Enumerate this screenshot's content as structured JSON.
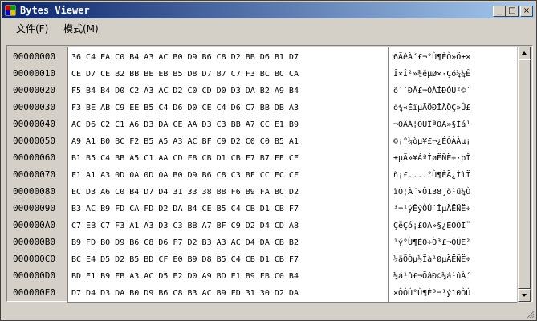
{
  "window": {
    "title": "Bytes Viewer"
  },
  "title_buttons": {
    "minimize": "_",
    "maximize": "□",
    "close": "×"
  },
  "menu": [
    {
      "label": "文件(F)"
    },
    {
      "label": "模式(M)"
    }
  ],
  "rows": [
    {
      "addr": "00000000",
      "hex": "36 C4 EA C0 B4 A3 AC B0  D9 B6 C8 D2 BB D6 B1 D7",
      "ascii": "6ÄêÀ´£¬°Ù¶ÈÒ»Ö±×"
    },
    {
      "addr": "00000010",
      "hex": "CE D7 CE B2 BB BE EB B5  D8 D7 B7 C7 F3 BC BC CA",
      "ascii": "Î×Î²»¾ëµØ×·Çó¼¼Ê"
    },
    {
      "addr": "00000020",
      "hex": "F5 B4 B4 D0 C2 A3 AC D2  C0 CD D0 D3 DA B2 A9 B4",
      "ascii": "õ´´ÐÂ£¬ÒÀÍÐÓÚ²©´"
    },
    {
      "addr": "00000030",
      "hex": "F3 BE AB C9 EE B5 C4 D6  D0 CE C4 D6 C7 BB DB A3",
      "ascii": "ó¾«ÉîµÄÖÐÎÄÖÇ»Û£"
    },
    {
      "addr": "00000040",
      "hex": "AC D6 C2 C1 A6 D3 DA CE  AA D3 C3 BB A7 CC E1 B9",
      "ascii": "¬ÖÂÁ¦ÓÚÎªÓÃ»§Ìá¹"
    },
    {
      "addr": "00000050",
      "hex": "A9 A1 B0 BC F2 B5 A5 A3  AC BF C9 D2 C0 C0 B5 A1",
      "ascii": "©¡°¼òµ¥£¬¿ÉÒÀÀµ¡"
    },
    {
      "addr": "00000060",
      "hex": "B1 B5 C4 BB A5 C1 AA CD  F8 CB D1 CB F7 B7 FE CE",
      "ascii": "±µÄ»¥ÁªÍøËÑË÷·þÎ"
    },
    {
      "addr": "00000070",
      "hex": "F1 A1 A3 0D 0A 0D 0A B0  D9 B6 C8 C3 BF CC EC CF",
      "ascii": "ñ¡£....°Ù¶ÈÃ¿ÌìÏ"
    },
    {
      "addr": "00000080",
      "hex": "EC D3 A6 C0 B4 D7 D4 31  33 38 B8 F6 B9 FA BC D2",
      "ascii": "ìÓ¦À´×Ô138¸ö¹ú¼Ò"
    },
    {
      "addr": "00000090",
      "hex": "B3 AC B9 FD CA FD D2 DA  B4 CE B5 C4 CB D1 CB F7",
      "ascii": "³¬¹ýÊýÒÚ´ÎµÄËÑË÷"
    },
    {
      "addr": "000000A0",
      "hex": "C7 EB C7 F3 A1 A3 D3 C3  BB A7 BF C9 D2 D4 CD A8",
      "ascii": "ÇëÇó¡£ÓÃ»§¿ÉÒÔÍ¨"
    },
    {
      "addr": "000000B0",
      "hex": "B9 FD B0 D9 B6 C8 D6 F7  D2 B3 A3 AC D4 DA CB B2",
      "ascii": "¹ý°Ù¶ÈÖ÷Ò³£¬ÔÚË²"
    },
    {
      "addr": "000000C0",
      "hex": "BC E4 D5 D2 B5 BD CF E0  B9 D8 B5 C4 CB D1 CB F7",
      "ascii": "¼äÕÒµ½Ïà¹ØµÄËÑË÷"
    },
    {
      "addr": "000000D0",
      "hex": "BD E1 B9 FB A3 AC D5 E2  D0 A9 BD E1 B9 FB C0 B4",
      "ascii": "½á¹û£¬ÕâÐ©½á¹ûÀ´"
    },
    {
      "addr": "000000E0",
      "hex": "D7 D4 D3 DA B0 D9 B6 C8  B3 AC B9 FD 31 30 D2 DA",
      "ascii": "×ÔÓÚ°Ù¶È³¬¹ý10ÒÚ"
    }
  ]
}
